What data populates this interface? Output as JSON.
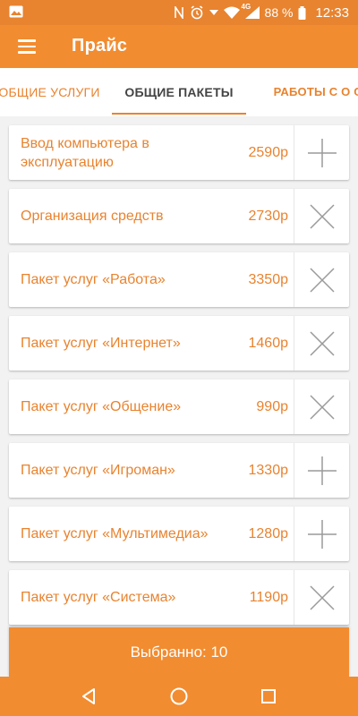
{
  "status_bar": {
    "network": "4G",
    "battery_percent": "88 %",
    "time": "12:33"
  },
  "app_bar": {
    "title": "Прайс"
  },
  "tabs": [
    {
      "label": "ОБЩИЕ УСЛУГИ",
      "selected": false
    },
    {
      "label": "ОБЩИЕ ПАКЕТЫ",
      "selected": true
    },
    {
      "label": "РАБОТЫ С О СИ",
      "selected": false
    }
  ],
  "items": [
    {
      "name": "Ввод компьютера в эксплуатацию",
      "price": "2590р",
      "action": "add"
    },
    {
      "name": "Организация средств",
      "price": "2730р",
      "action": "remove"
    },
    {
      "name": "Пакет услуг «Работа»",
      "price": "3350р",
      "action": "remove"
    },
    {
      "name": "Пакет услуг «Интернет»",
      "price": "1460р",
      "action": "remove"
    },
    {
      "name": "Пакет услуг «Общение»",
      "price": "990р",
      "action": "remove"
    },
    {
      "name": "Пакет услуг «Игроман»",
      "price": "1330р",
      "action": "add"
    },
    {
      "name": "Пакет услуг «Мультимедиа»",
      "price": "1280р",
      "action": "add"
    },
    {
      "name": "Пакет услуг «Система»",
      "price": "1190р",
      "action": "remove"
    }
  ],
  "footer": {
    "label": "Выбранно: 10"
  },
  "colors": {
    "accent": "#f28c30",
    "status_bar": "#e8832f",
    "text_accent": "#e8832f",
    "icon_gray": "#9a9a9a"
  }
}
